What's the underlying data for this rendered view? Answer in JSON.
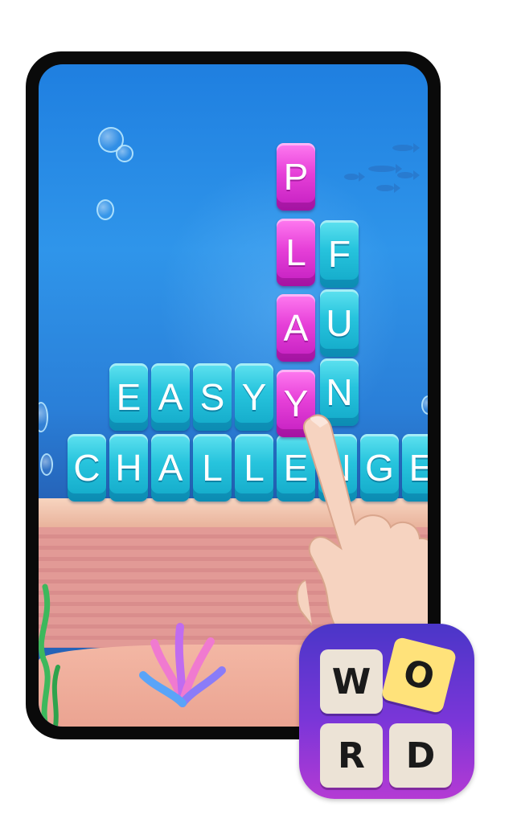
{
  "screen": {
    "word_rows": [
      {
        "name": "challenge",
        "letters": [
          "C",
          "H",
          "A",
          "L",
          "L",
          "E",
          "N",
          "G",
          "E"
        ]
      },
      {
        "name": "easy",
        "letters": [
          "E",
          "A",
          "S",
          "Y"
        ]
      }
    ],
    "play_column": [
      "P",
      "L",
      "A",
      "Y"
    ],
    "fun_column": [
      "F",
      "U",
      "N"
    ]
  },
  "app_icon": {
    "tiles": [
      "W",
      "O",
      "R",
      "D"
    ]
  },
  "colors": {
    "water": "#2f95ea",
    "cyan_tile": "#27c4dd",
    "pink_tile": "#e640d8",
    "icon_bg": "#7a36d8",
    "icon_tile": "#ece3d6",
    "icon_tile_highlight": "#ffe27a"
  }
}
